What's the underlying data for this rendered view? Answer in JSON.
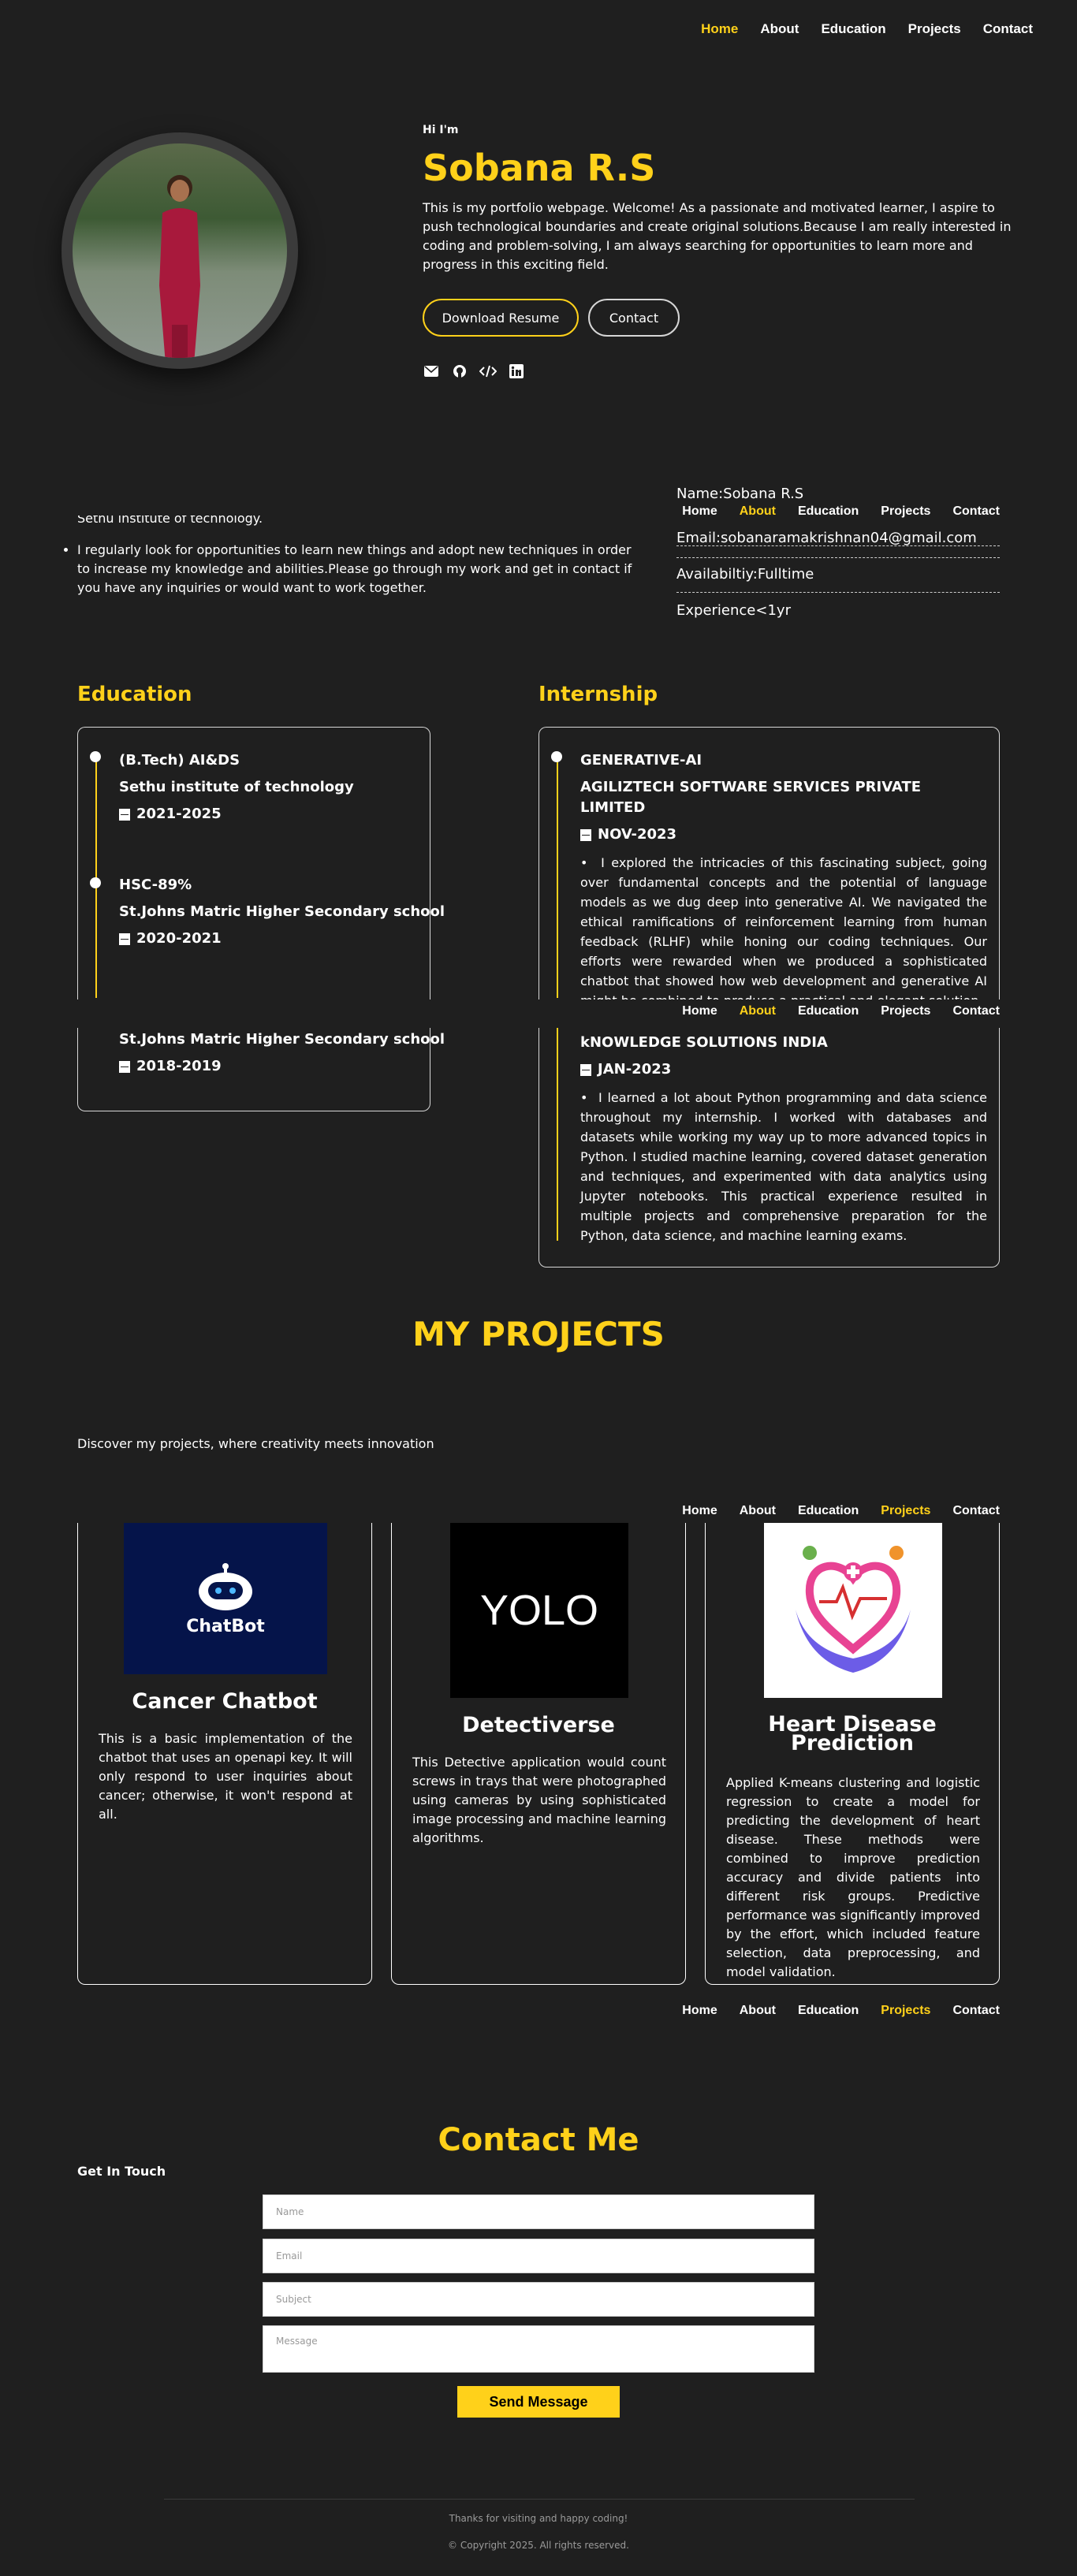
{
  "nav": {
    "items": [
      "Home",
      "About",
      "Education",
      "Projects",
      "Contact"
    ]
  },
  "hero": {
    "greeting": "Hi I'm",
    "name": "Sobana R.S",
    "intro": "This is my portfolio webpage. Welcome! As a passionate and motivated learner, I aspire to push technological boundaries and create original solutions.Because I am really interested in coding and problem-solving, I am always searching for opportunities to learn more and progress in this exciting field.",
    "download_label": "Download Resume",
    "contact_label": "Contact",
    "social_icons": [
      "envelope-icon",
      "github-icon",
      "code-icon",
      "linkedin-icon"
    ]
  },
  "about": {
    "partial_line": "Sethu institute of technology.",
    "bullet": "I regularly look for opportunities to learn new things and adopt new techniques in order to increase my knowledge and abilities.Please go through my work and get in contact if you have any inquiries or would want to work together.",
    "info": [
      "Name:Sobana R.S",
      "Email:sobanaramakrishnan04@gmail.com",
      "Availabiltiy:Fulltime",
      "Experience<1yr"
    ]
  },
  "education": {
    "title": "Education",
    "items": [
      {
        "degree": "(B.Tech) AI&DS",
        "school": "Sethu institute of technology",
        "years": "2021-2025"
      },
      {
        "degree": "HSC-89%",
        "school": "St.Johns Matric Higher Secondary school",
        "years": "2020-2021"
      },
      {
        "degree": "",
        "school": "St.Johns Matric Higher Secondary school",
        "years": "2018-2019"
      }
    ]
  },
  "internship": {
    "title": "Internship",
    "items": [
      {
        "role": "GENERATIVE-AI",
        "company": "AGILIZTECH SOFTWARE SERVICES PRIVATE LIMITED",
        "date": "NOV-2023",
        "desc": "I explored the intricacies of this fascinating subject, going over fundamental concepts and the potential of language models as we dug deep into generative AI. We navigated the ethical ramifications of reinforcement learning from human feedback (RLHF) while honing our coding techniques. Our efforts were rewarded when we produced a sophisticated chatbot that showed how web development and generative AI might be combined to produce a practical and elegant solution."
      },
      {
        "role": "",
        "company": "kNOWLEDGE SOLUTIONS INDIA",
        "date": "JAN-2023",
        "desc": "I learned a lot about Python programming and data science throughout my internship. I worked with databases and datasets while working my way up to more advanced topics in Python. I studied machine learning, covered dataset generation and techniques, and experimented with data analytics using Jupyter notebooks. This practical experience resulted in multiple projects and comprehensive preparation for the Python, data science, and machine learning exams."
      }
    ]
  },
  "projects": {
    "title": "MY PROJECTS",
    "subtitle": "Discover my projects, where creativity meets innovation",
    "items": [
      {
        "name": "Cancer Chatbot",
        "image_text": "ChatBot",
        "desc": "This is a basic implementation of the chatbot that uses an openapi key. It will only respond to user inquiries about cancer; otherwise, it won't respond at all."
      },
      {
        "name": "Detectiverse",
        "image_text": "YOLO",
        "desc": "This Detective application would count screws in trays that were photographed using cameras by using sophisticated image processing and machine learning algorithms."
      },
      {
        "name": "Heart Disease Prediction",
        "image_text": "",
        "desc": "Applied K-means clustering and logistic regression to create a model for predicting the development of heart disease. These methods were combined to improve prediction accuracy and divide patients into different risk groups. Predictive performance was significantly improved by the effort, which included feature selection, data preprocessing, and model validation."
      }
    ]
  },
  "contact": {
    "title": "Contact Me",
    "get_in_touch": "Get In Touch",
    "placeholders": {
      "name": "Name",
      "email": "Email",
      "subject": "Subject",
      "message": "Message"
    },
    "send_label": "Send Message"
  },
  "footer": {
    "thanks": "Thanks for visiting and happy coding!",
    "copyright": "© Copyright 2025. All rights reserved."
  },
  "colors": {
    "accent": "#ffd11a",
    "background": "#1f1f1f"
  }
}
